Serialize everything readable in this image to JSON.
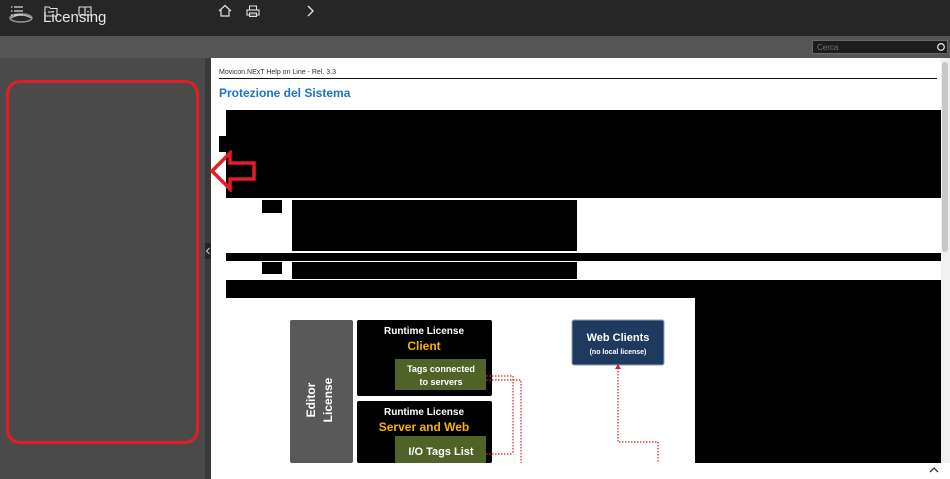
{
  "app": {
    "title": "Licensing"
  },
  "toolbar": {
    "search_placeholder": "Cerca"
  },
  "content": {
    "breadcrumb": "Movicon.NExT Help on Line - Rel. 3.3",
    "page_title": "Protezione del Sistema"
  },
  "diagram": {
    "editor_license": [
      "Editor",
      "License"
    ],
    "client_box": {
      "title": "Runtime License",
      "subtitle": "Client",
      "tag": [
        "Tags connected",
        "to servers"
      ]
    },
    "server_box": {
      "title": "Runtime License",
      "subtitle": "Server and Web",
      "tag": "I/O Tags List"
    },
    "web_clients": {
      "title": "Web Clients",
      "note": "(no local license)"
    }
  },
  "colors": {
    "accent_title": "#1a73c8",
    "annotation_red": "#e51c23",
    "diagram_gold": "#f5b400",
    "diagram_green": "#4f6228",
    "diagram_navy": "#1f3a5f",
    "editor_gray": "#595959"
  },
  "icons": [
    "menu-icon",
    "folder-icon",
    "book-icon",
    "home-icon",
    "print-icon",
    "chevron-right-icon",
    "search-icon",
    "chevron-up-icon",
    "chevron-left-icon"
  ]
}
